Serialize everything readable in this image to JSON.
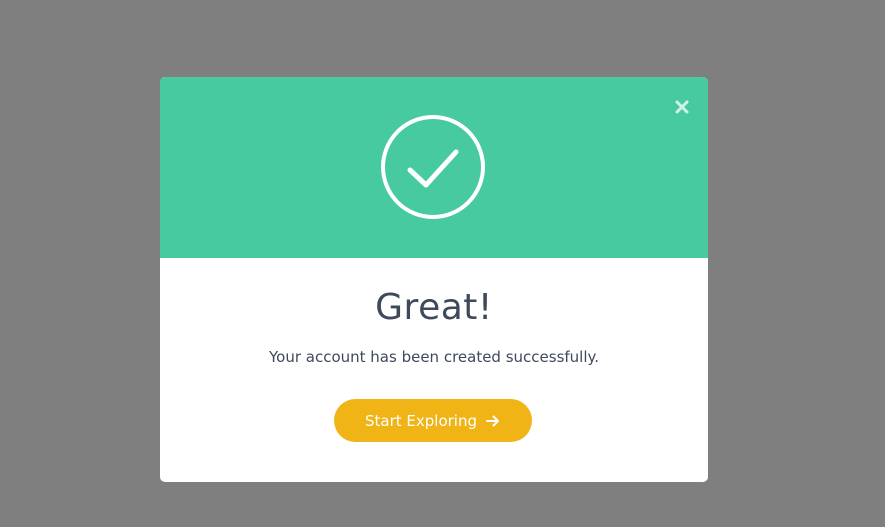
{
  "dialog": {
    "title": "Great!",
    "message": "Your account has been created successfully.",
    "cta_label": "Start Exploring",
    "close_label": "close"
  },
  "icons": {
    "header": "check-circle-icon",
    "close": "close-icon",
    "cta": "arrow-right-icon"
  },
  "colors": {
    "backdrop": "#7f7f7f",
    "header": "#48caa1",
    "button": "#f0b416",
    "text": "#3e4a5c"
  }
}
